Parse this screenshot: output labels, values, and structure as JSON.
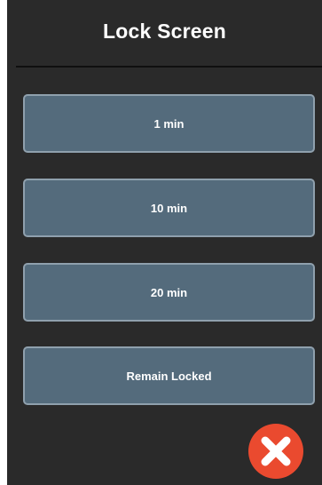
{
  "header": {
    "title": "Lock Screen"
  },
  "options": [
    {
      "label": "1 min"
    },
    {
      "label": "10 min"
    },
    {
      "label": "20 min"
    },
    {
      "label": "Remain Locked"
    }
  ],
  "close_button": {
    "icon": "close-icon",
    "color": "#ea4a2f"
  },
  "colors": {
    "panel_background": "#2a2a2a",
    "button_background": "#546b7c",
    "button_border": "#8fa0ad"
  }
}
